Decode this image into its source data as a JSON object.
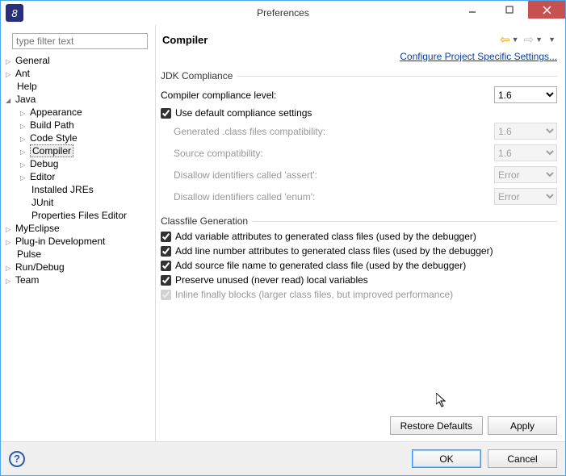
{
  "window": {
    "title": "Preferences"
  },
  "filter": {
    "placeholder": "type filter text"
  },
  "tree": {
    "general": "General",
    "ant": "Ant",
    "help": "Help",
    "java": "Java",
    "java_children": {
      "appearance": "Appearance",
      "build_path": "Build Path",
      "code_style": "Code Style",
      "compiler": "Compiler",
      "debug": "Debug",
      "editor": "Editor",
      "installed_jres": "Installed JREs",
      "junit": "JUnit",
      "properties_editor": "Properties Files Editor"
    },
    "myeclipse": "MyEclipse",
    "plugin_dev": "Plug-in Development",
    "pulse": "Pulse",
    "run_debug": "Run/Debug",
    "team": "Team"
  },
  "main": {
    "heading": "Compiler",
    "configure_link": "Configure Project Specific Settings...",
    "group_jdk": "JDK Compliance",
    "compliance_level_label": "Compiler compliance level:",
    "compliance_level_value": "1.6",
    "use_default_label": "Use default compliance settings",
    "gen_class_label": "Generated .class files compatibility:",
    "gen_class_value": "1.6",
    "source_compat_label": "Source compatibility:",
    "source_compat_value": "1.6",
    "disallow_assert_label": "Disallow identifiers called 'assert':",
    "disallow_assert_value": "Error",
    "disallow_enum_label": "Disallow identifiers called 'enum':",
    "disallow_enum_value": "Error",
    "group_classfile": "Classfile Generation",
    "cf_var_attrs": "Add variable attributes to generated class files (used by the debugger)",
    "cf_line_numbers": "Add line number attributes to generated class files (used by the debugger)",
    "cf_source_name": "Add source file name to generated class file (used by the debugger)",
    "cf_preserve_unused": "Preserve unused (never read) local variables",
    "cf_inline_finally": "Inline finally blocks (larger class files, but improved performance)",
    "restore_defaults": "Restore Defaults",
    "apply": "Apply"
  },
  "footer": {
    "ok": "OK",
    "cancel": "Cancel"
  }
}
